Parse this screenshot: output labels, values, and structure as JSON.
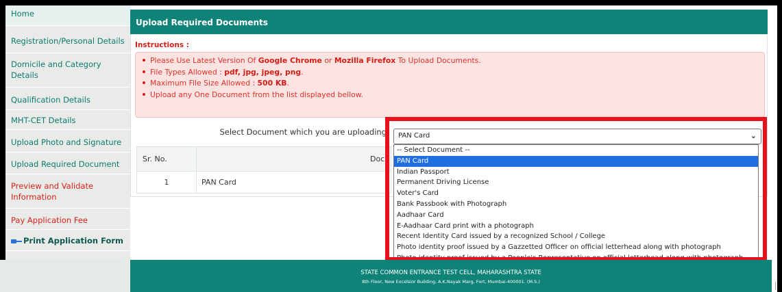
{
  "sidebar": {
    "items": [
      {
        "label": "Home"
      },
      {
        "label": "Registration/Personal Details"
      },
      {
        "label": "Domicile and Category Details"
      },
      {
        "label": "Qualification Details"
      },
      {
        "label": "MHT-CET Details"
      },
      {
        "label": "Upload Photo and Signature"
      },
      {
        "label": "Upload Required Document"
      },
      {
        "label": "Preview and Validate Information"
      },
      {
        "label": "Pay Application Fee"
      },
      {
        "label": "Print Application Form",
        "icon": "pointing-hand-icon"
      }
    ]
  },
  "panel": {
    "title": "Upload Required Documents",
    "instructions_title": "Instructions :",
    "instructions": [
      {
        "pre": "Please Use Latest Version Of ",
        "b1": "Google Chrome",
        "mid": " or ",
        "b2": "Mozilla Firefox",
        "post": " To Upload Documents."
      },
      {
        "pre": "File Types Allowed : ",
        "b1": "pdf, jpg, jpeg, png",
        "post": "."
      },
      {
        "pre": "Maximum File Size Allowed : ",
        "b1": "500 KB",
        "post": "."
      },
      {
        "pre": "Upload any One Document from the list displayed bellow."
      }
    ],
    "select_label": "Select Document which you are uploading",
    "selected_value": "PAN Card",
    "options": [
      "-- Select Document --",
      "PAN Card",
      "Indian Passport",
      "Permanent Driving License",
      "Voter's Card",
      "Bank Passbook with Photograph",
      "Aadhaar Card",
      "E-Aadhaar Card print with a photograph",
      "Recent Identity Card issued by a recognized School / College",
      "Photo identity proof issued by a Gazzetted Officer on official letterhead along with photograph",
      "Photo identity proof issued by a People's Representative on official letterhead along with photograph"
    ],
    "highlighted_option_index": 1,
    "table": {
      "headers": [
        "Sr. No.",
        "Docu"
      ],
      "rows": [
        {
          "sr": "1",
          "doc": "PAN Card"
        }
      ]
    }
  },
  "footer": {
    "line1": "STATE COMMON ENTRANCE TEST CELL, MAHARASHTRA STATE",
    "line2": "8th Floor, New Excelsior Building, A.K.Nayak Marg, Fort, Mumbai-400001. (M.S.)"
  },
  "colors": {
    "brand": "#0f8377",
    "annotation": "#e8101b",
    "highlight": "#1f6fe0",
    "instruction": "#d41c15"
  }
}
